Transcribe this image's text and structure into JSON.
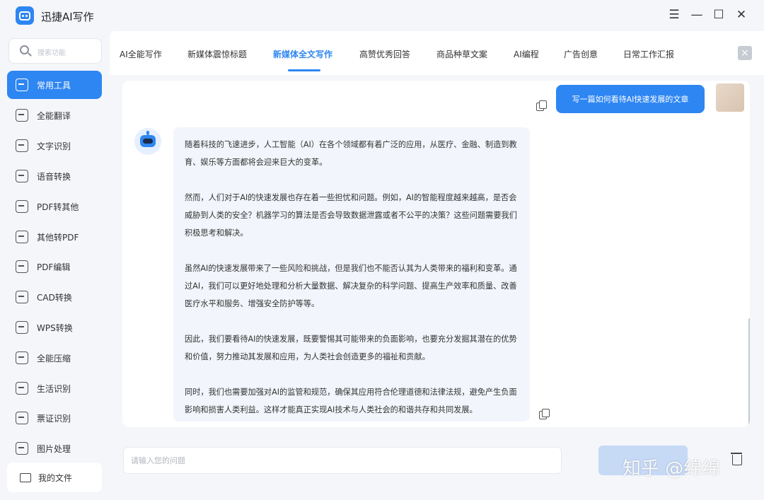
{
  "app": {
    "title": "迅捷AI写作"
  },
  "window_controls": {
    "menu": "☰",
    "minimize": "—",
    "maximize": "☐",
    "close": "✕"
  },
  "sidebar": {
    "search_placeholder": "搜索功能",
    "items": [
      {
        "label": "常用工具",
        "icon": "toolbox-icon",
        "active": true
      },
      {
        "label": "全能翻译",
        "icon": "translate-icon"
      },
      {
        "label": "文字识别",
        "icon": "text-recognize-icon"
      },
      {
        "label": "语音转换",
        "icon": "voice-icon"
      },
      {
        "label": "PDF转其他",
        "icon": "pdf-convert-icon"
      },
      {
        "label": "其他转PDF",
        "icon": "to-pdf-icon"
      },
      {
        "label": "PDF编辑",
        "icon": "pdf-edit-icon"
      },
      {
        "label": "CAD转换",
        "icon": "cad-icon"
      },
      {
        "label": "WPS转换",
        "icon": "wps-icon"
      },
      {
        "label": "全能压缩",
        "icon": "compress-icon"
      },
      {
        "label": "生活识别",
        "icon": "eye-icon"
      },
      {
        "label": "票证识别",
        "icon": "ticket-icon"
      },
      {
        "label": "图片处理",
        "icon": "image-edit-icon"
      }
    ],
    "my_files": "我的文件"
  },
  "tabs": [
    {
      "label": "AI全能写作"
    },
    {
      "label": "新媒体震惊标题"
    },
    {
      "label": "新媒体全文写作",
      "active": true
    },
    {
      "label": "高赞优秀回答"
    },
    {
      "label": "商品种草文案"
    },
    {
      "label": "AI编程"
    },
    {
      "label": "广告创意"
    },
    {
      "label": "日常工作汇报"
    }
  ],
  "chat": {
    "user_message": "写一篇如何看待AI快速发展的文章",
    "bot_paragraphs": [
      "随着科技的飞速进步，人工智能（AI）在各个领域都有着广泛的应用，从医疗、金融、制造到教育、娱乐等方面都将会迎来巨大的变革。",
      "然而，人们对于AI的快速发展也存在着一些担忧和问题。例如，AI的智能程度越来越高，是否会威胁到人类的安全？机器学习的算法是否会导致数据泄露或者不公平的决策？这些问题需要我们积极思考和解决。",
      "虽然AI的快速发展带来了一些风险和挑战，但是我们也不能否认其为人类带来的福利和变革。通过AI，我们可以更好地处理和分析大量数据、解决复杂的科学问题、提高生产效率和质量、改善医疗水平和服务、增强安全防护等等。",
      "因此，我们要看待AI的快速发展，既要警惕其可能带来的负面影响，也要充分发掘其潜在的优势和价值，努力推动其发展和应用，为人类社会创造更多的福祉和贡献。",
      "同时，我们也需要加强对AI的监管和规范，确保其应用符合伦理道德和法律法规，避免产生负面影响和损害人类利益。这样才能真正实现AI技术与人类社会的和谐共存和共同发展。"
    ]
  },
  "input": {
    "placeholder": "请输入您的问题"
  },
  "send_button": {
    "label": ""
  },
  "watermark": "知乎 @绵绵",
  "colors": {
    "accent": "#2e86f2",
    "background": "#f4f6fa",
    "bubble": "#f2f5fb"
  }
}
